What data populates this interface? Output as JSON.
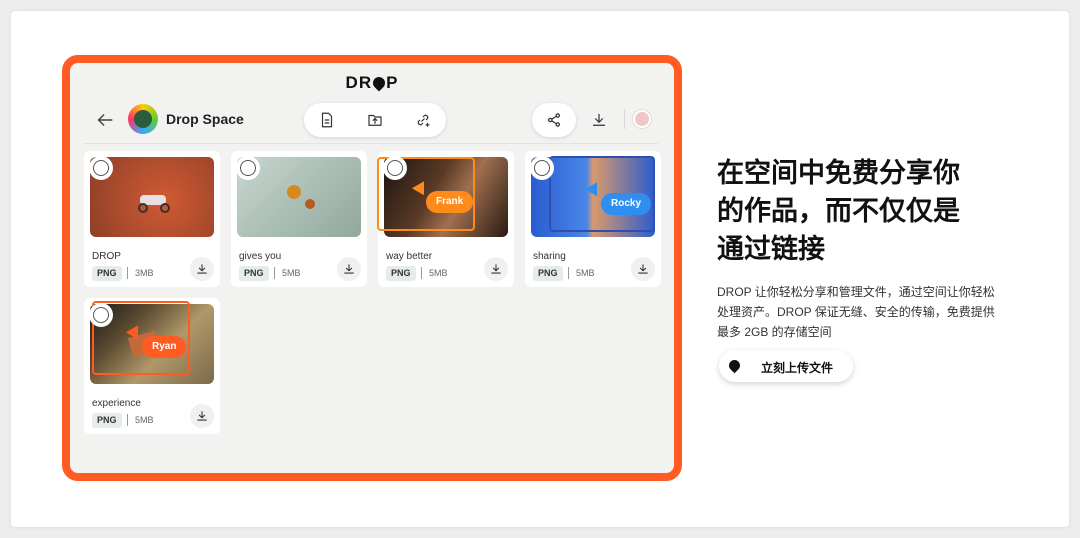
{
  "app": {
    "brand_pre": "DR",
    "brand_post": "P",
    "space_title": "Drop Space"
  },
  "toolbar": {
    "back": "back-arrow-icon",
    "tools": [
      "new-file-icon",
      "upload-folder-icon",
      "add-link-icon"
    ],
    "share": "share-icon",
    "download": "download-icon"
  },
  "files": [
    {
      "name": "DROP",
      "type": "PNG",
      "size": "3MB"
    },
    {
      "name": "gives you",
      "type": "PNG",
      "size": "5MB"
    },
    {
      "name": "way better",
      "type": "PNG",
      "size": "5MB"
    },
    {
      "name": "sharing",
      "type": "PNG",
      "size": "5MB"
    },
    {
      "name": "experience",
      "type": "PNG",
      "size": "5MB"
    }
  ],
  "collaborators": [
    {
      "name": "Frank",
      "color": "#ff8c1a"
    },
    {
      "name": "Rocky",
      "color": "#2f8ff0"
    },
    {
      "name": "Ryan",
      "color": "#ff5b22"
    }
  ],
  "hero": {
    "headline_line1": "在空间中免费分享你",
    "headline_line2": "的作品，而不仅仅是",
    "headline_line3": "通过链接",
    "desc_line1": "DROP 让你轻松分享和管理文件，通过空间让你轻松",
    "desc_line2": "处理资产。DROP 保证无缝、安全的传输，免费提供",
    "desc_line3": "最多 2GB 的存储空间",
    "cta_label": "立刻上传文件"
  },
  "colors": {
    "accent": "#ff5b22",
    "frank": "#ff8c1a",
    "rocky": "#2f8ff0"
  }
}
